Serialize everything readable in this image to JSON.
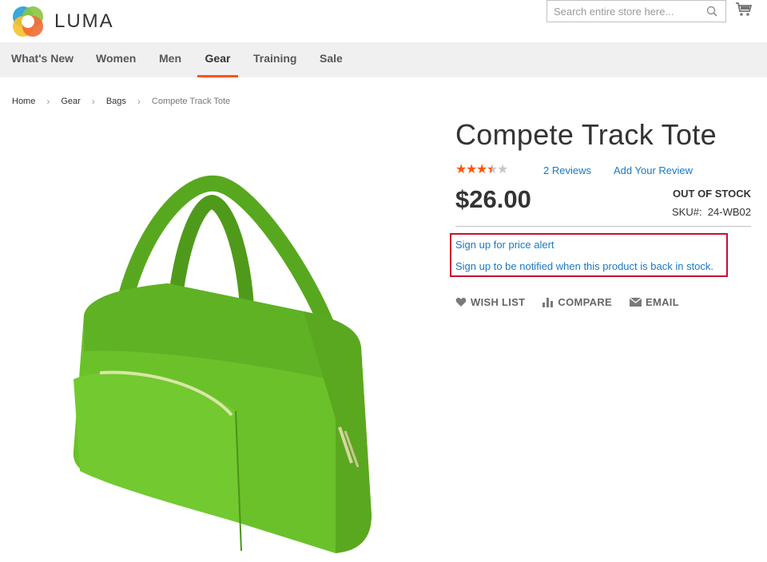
{
  "header": {
    "logo_text": "LUMA",
    "search_placeholder": "Search entire store here...",
    "search_icon": "search-icon",
    "cart_icon": "cart-icon"
  },
  "nav": {
    "items": [
      {
        "label": "What's New"
      },
      {
        "label": "Women"
      },
      {
        "label": "Men"
      },
      {
        "label": "Gear",
        "active": true
      },
      {
        "label": "Training"
      },
      {
        "label": "Sale"
      }
    ]
  },
  "breadcrumbs": {
    "items": [
      "Home",
      "Gear",
      "Bags"
    ],
    "current": "Compete Track Tote"
  },
  "product": {
    "title": "Compete Track Tote",
    "rating_fraction": 0.7,
    "reviews_label": "2 Reviews",
    "add_review_label": "Add Your Review",
    "price": "$26.00",
    "stock_status": "OUT OF STOCK",
    "sku_label": "SKU#:",
    "sku_value": "24-WB02",
    "price_alert_link": "Sign up for price alert",
    "stock_alert_link": "Sign up to be notified when this product is back in stock.",
    "image_icon": "green-tote-bag-image"
  },
  "actions": {
    "wishlist": "WISH LIST",
    "compare": "COMPARE",
    "email": "EMAIL"
  },
  "colors": {
    "accent": "#ff5501",
    "link": "#1979c3",
    "highlight_border": "#c8102e",
    "star_filled": "#ff5501",
    "star_empty": "#c7c7c7",
    "bag_green": "#6ac12a"
  }
}
